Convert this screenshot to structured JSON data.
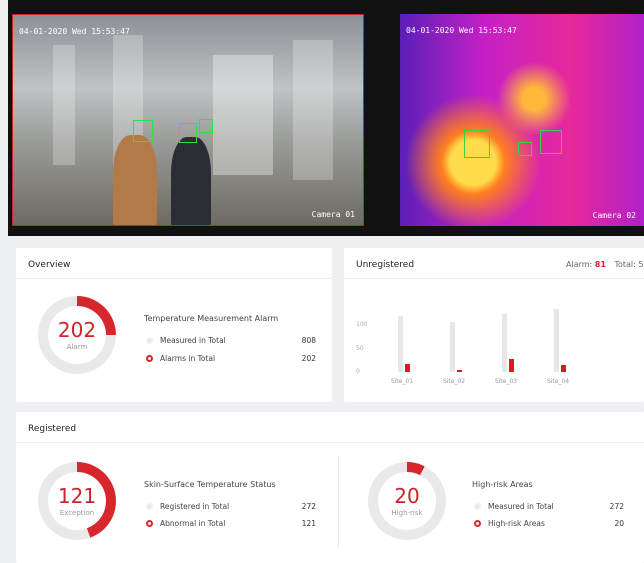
{
  "cameras": {
    "left": {
      "timestamp": "04-01-2020 Wed 15:53:47",
      "label": "Camera 01"
    },
    "right": {
      "timestamp": "04-01-2020 Wed 15:53:47",
      "label": "Camera 02"
    }
  },
  "overview": {
    "title": "Overview",
    "ring": {
      "value": "202",
      "label": "Alarm",
      "fraction": 0.25
    },
    "stat_title": "Temperature Measurement Alarm",
    "rows": [
      {
        "label": "Measured in Total",
        "value": "808"
      },
      {
        "label": "Alarms in Total",
        "value": "202"
      }
    ]
  },
  "unregistered": {
    "title": "Unregistered",
    "alarm_label": "Alarm:",
    "alarm_value": "81",
    "total_label": "Total: 5"
  },
  "registered": {
    "title": "Registered",
    "left": {
      "ring": {
        "value": "121",
        "label": "Exception",
        "fraction": 0.445
      },
      "stat_title": "Skin-Surface Temperature Status",
      "rows": [
        {
          "label": "Registered in Total",
          "value": "272"
        },
        {
          "label": "Abnormal in Total",
          "value": "121"
        }
      ]
    },
    "right": {
      "ring": {
        "value": "20",
        "label": "High-risk",
        "fraction": 0.074
      },
      "stat_title": "High-risk Areas",
      "rows": [
        {
          "label": "Measured in Total",
          "value": "272"
        },
        {
          "label": "High-risk Areas",
          "value": "20"
        }
      ]
    }
  },
  "colors": {
    "accent": "#d7272d",
    "ring_track": "#e9e9e9",
    "bar_grey": "#e7e7e7",
    "bar_red": "#e0171e"
  },
  "chart_data": {
    "type": "bar",
    "categories": [
      "Site_01",
      "Site_02",
      "Site_03",
      "Site_04"
    ],
    "series": [
      {
        "values": [
          120,
          108,
          125,
          135
        ]
      },
      {
        "values": [
          17,
          5,
          28,
          16
        ]
      }
    ],
    "yticks": [
      "0",
      "50",
      "100"
    ],
    "ylim": [
      0,
      150
    ]
  }
}
